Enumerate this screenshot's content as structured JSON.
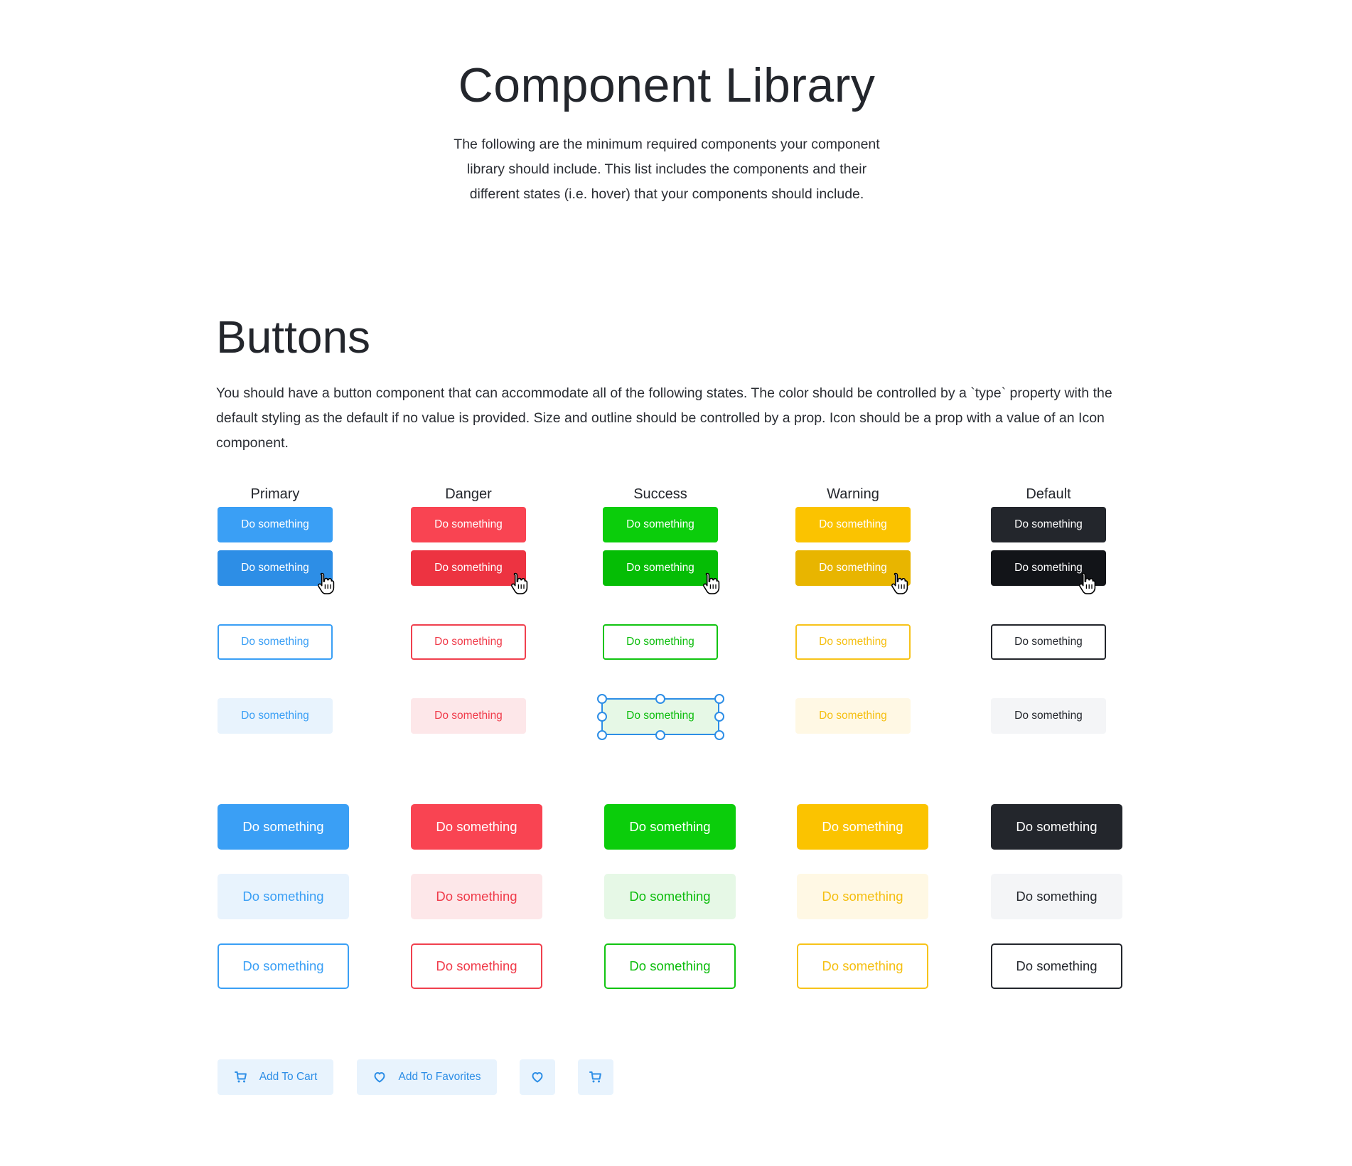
{
  "page": {
    "title": "Component Library",
    "intro": "The following are the minimum required components your component library should include. This list includes the components and their different states (i.e. hover) that your components should include."
  },
  "buttons_section": {
    "title": "Buttons",
    "description": "You should have a button component that can accommodate all of the following states. The color should be controlled by a `type` property with the default styling as the default if no value is provided. Size and outline should be controlled by a prop. Icon should be a prop with a value of an Icon component."
  },
  "button_label": "Do something",
  "columns": [
    {
      "name": "Primary",
      "solid": "#3a9ff5",
      "hover": "#2d8ee6",
      "text_on_light": "#2d8ee6",
      "light_bg": "#e8f3fd",
      "outline": "#3a9ff5"
    },
    {
      "name": "Danger",
      "solid": "#f94452",
      "hover": "#ed3341",
      "text_on_light": "#f03a49",
      "light_bg": "#fde7e9",
      "outline": "#f0404e"
    },
    {
      "name": "Success",
      "solid": "#0bcd0b",
      "hover": "#05bd05",
      "text_on_light": "#0cbd0c",
      "light_bg": "#e6f8e6",
      "outline": "#11c411"
    },
    {
      "name": "Warning",
      "solid": "#fbc300",
      "hover": "#e8b500",
      "text_on_light": "#f5bf10",
      "light_bg": "#fff8e4",
      "outline": "#f7c31a"
    },
    {
      "name": "Default",
      "solid": "#23262c",
      "hover": "#121418",
      "text_on_light": "#23262c",
      "light_bg": "#f4f5f7",
      "outline": "#23262c"
    }
  ],
  "icon_buttons": [
    {
      "label": "Add To Cart",
      "icon": "cart-icon"
    },
    {
      "label": "Add To Favorites",
      "icon": "heart-icon"
    },
    {
      "label": "",
      "icon": "heart-icon"
    },
    {
      "label": "",
      "icon": "cart-icon"
    }
  ],
  "icon_button_colors": {
    "bg": "#e8f3fd",
    "fg": "#2d8ee6"
  }
}
